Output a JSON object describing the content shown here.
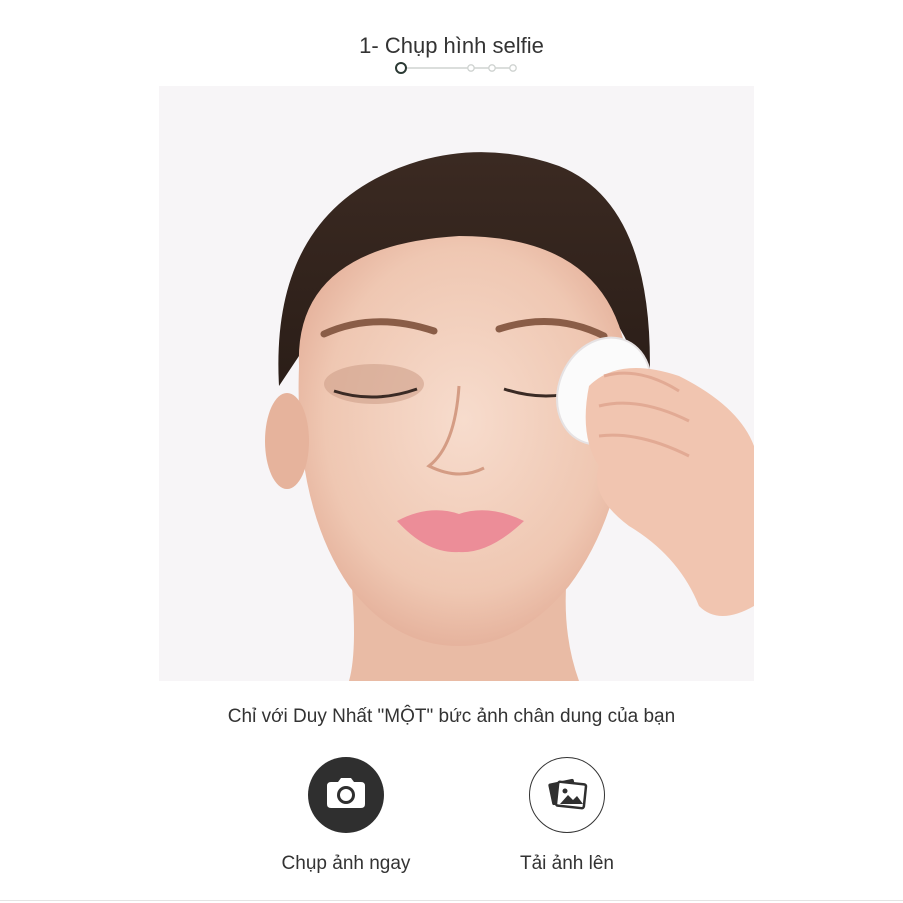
{
  "step": {
    "title": "1- Chụp hình selfie",
    "current": 1,
    "total": 4
  },
  "photo": {
    "description_icon": "selfie-photo"
  },
  "tagline": "Chỉ với Duy Nhất \"MỘT\" bức ảnh chân dung của bạn",
  "actions": {
    "take_photo": {
      "label": "Chụp ảnh ngay",
      "icon": "camera-icon"
    },
    "upload_photo": {
      "label": "Tải ảnh lên",
      "icon": "image-icon"
    }
  },
  "colors": {
    "accent_dark": "#2f2f2f",
    "stepper_active": "#2b3a34",
    "stepper_inactive": "#cfd3d1"
  }
}
